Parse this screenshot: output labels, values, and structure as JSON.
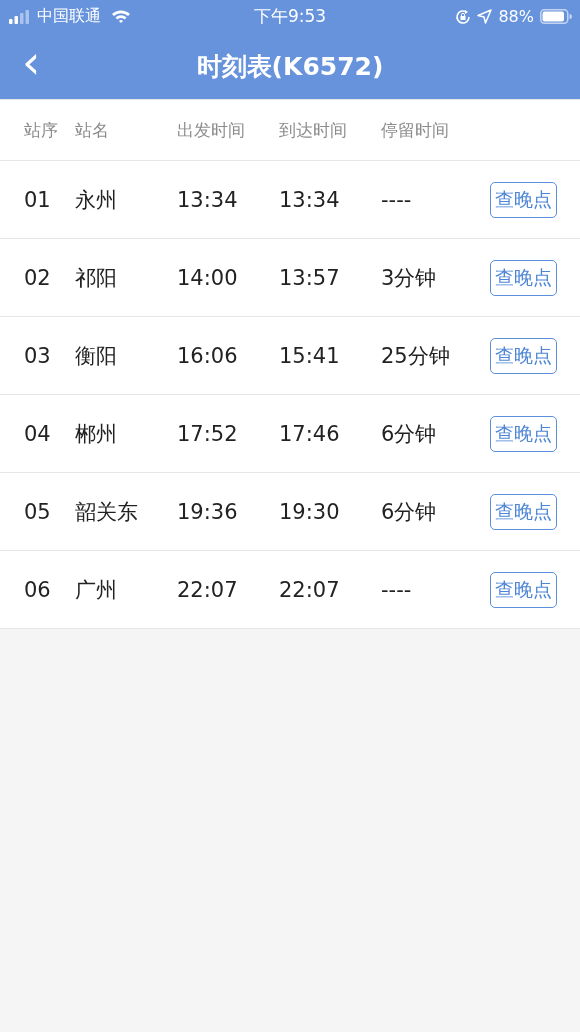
{
  "status_bar": {
    "carrier": "中国联通",
    "time": "下午9:53",
    "battery": "88%"
  },
  "nav": {
    "back_icon": "‹",
    "title": "时刻表(K6572)"
  },
  "table": {
    "columns": [
      "站序",
      "站名",
      "出发时间",
      "到达时间",
      "停留时间"
    ],
    "rows": [
      {
        "seq": "01",
        "station": "永州",
        "depart": "13:34",
        "arrive": "13:34",
        "stop": "----",
        "action": "查晚点"
      },
      {
        "seq": "02",
        "station": "祁阳",
        "depart": "14:00",
        "arrive": "13:57",
        "stop": "3分钟",
        "action": "查晚点"
      },
      {
        "seq": "03",
        "station": "衡阳",
        "depart": "16:06",
        "arrive": "15:41",
        "stop": "25分钟",
        "action": "查晚点"
      },
      {
        "seq": "04",
        "station": "郴州",
        "depart": "17:52",
        "arrive": "17:46",
        "stop": "6分钟",
        "action": "查晚点"
      },
      {
        "seq": "05",
        "station": "韶关东",
        "depart": "19:36",
        "arrive": "19:30",
        "stop": "6分钟",
        "action": "查晚点"
      },
      {
        "seq": "06",
        "station": "广州",
        "depart": "22:07",
        "arrive": "22:07",
        "stop": "----",
        "action": "查晚点"
      }
    ]
  }
}
